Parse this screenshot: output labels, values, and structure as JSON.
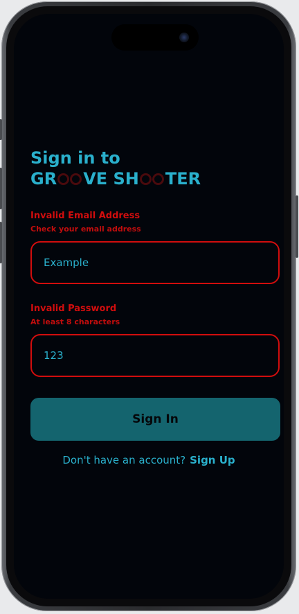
{
  "title": {
    "line1": "Sign in to",
    "brand_part1": "GR",
    "brand_part2": "VE SH",
    "brand_part3": "TER"
  },
  "email": {
    "error_title": "Invalid Email Address",
    "error_subtitle": "Check your email address",
    "value": "Example"
  },
  "password": {
    "error_title": "Invalid Password",
    "error_subtitle": "At least 8 characters",
    "value": "123"
  },
  "sign_in_label": "Sign In",
  "footer": {
    "prompt": "Don't have an account?",
    "link": "Sign Up"
  },
  "colors": {
    "accent": "#2ab0cc",
    "error": "#d10d0d",
    "button": "#14646e",
    "background": "#02050b"
  }
}
